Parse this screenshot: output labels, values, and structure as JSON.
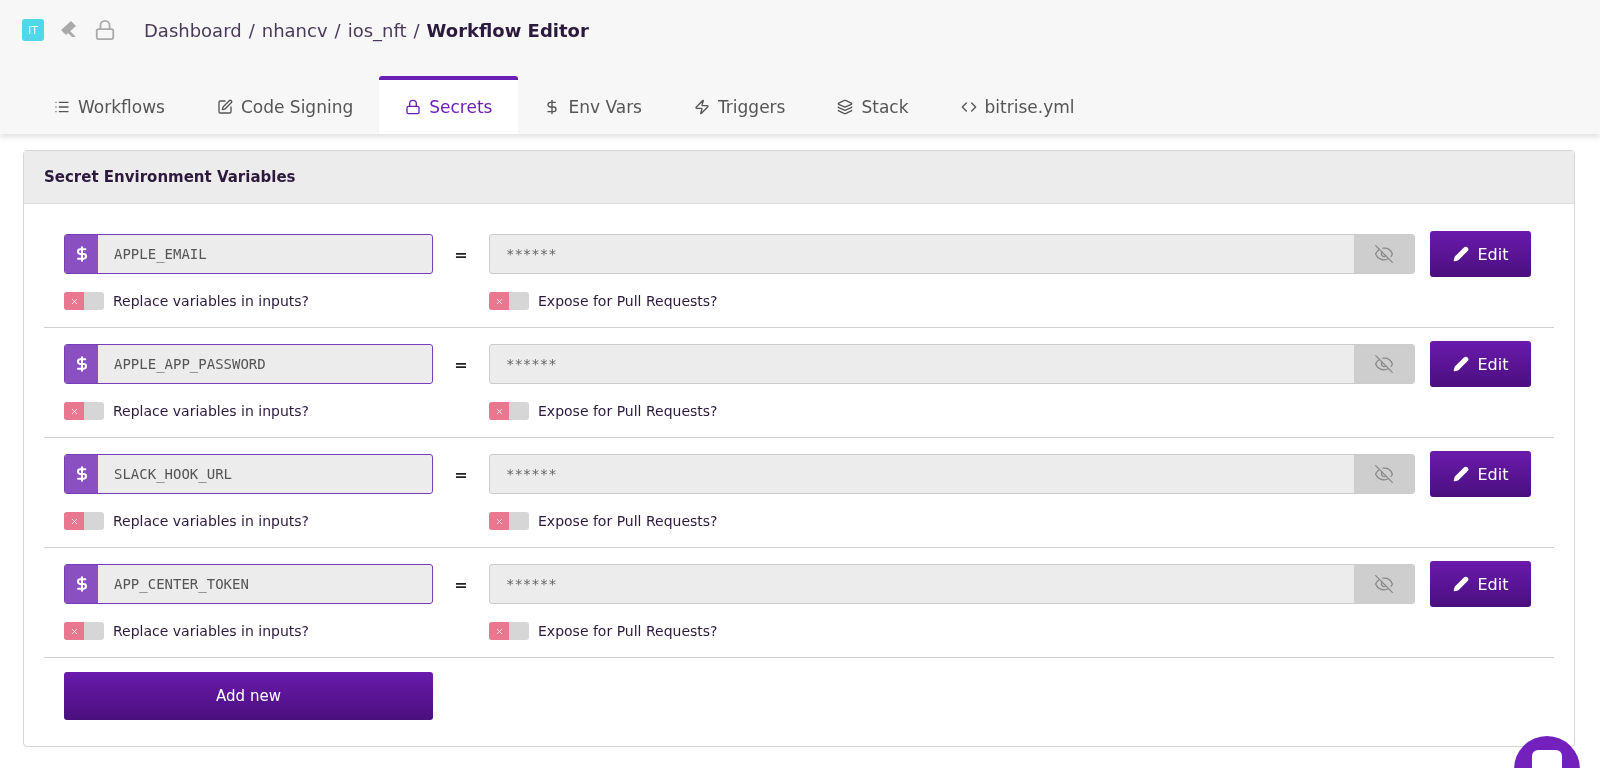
{
  "header": {
    "avatar": "IT",
    "breadcrumb": [
      "Dashboard",
      "nhancv",
      "ios_nft"
    ],
    "separator": "/",
    "current": "Workflow Editor"
  },
  "tabs": [
    {
      "label": "Workflows",
      "selected": false
    },
    {
      "label": "Code Signing",
      "selected": false
    },
    {
      "label": "Secrets",
      "selected": true
    },
    {
      "label": "Env Vars",
      "selected": false
    },
    {
      "label": "Triggers",
      "selected": false
    },
    {
      "label": "Stack",
      "selected": false
    },
    {
      "label": "bitrise.yml",
      "selected": false
    }
  ],
  "panel": {
    "title": "Secret Environment Variables",
    "secrets": [
      {
        "key": "APPLE_EMAIL",
        "equals": "=",
        "value": "******",
        "edit": "Edit",
        "replace": {
          "label": "Replace variables in inputs?",
          "on": false
        },
        "expose": {
          "label": "Expose for Pull Requests?",
          "on": false
        }
      },
      {
        "key": "APPLE_APP_PASSWORD",
        "equals": "=",
        "value": "******",
        "edit": "Edit",
        "replace": {
          "label": "Replace variables in inputs?",
          "on": false
        },
        "expose": {
          "label": "Expose for Pull Requests?",
          "on": false
        }
      },
      {
        "key": "SLACK_HOOK_URL",
        "equals": "=",
        "value": "******",
        "edit": "Edit",
        "replace": {
          "label": "Replace variables in inputs?",
          "on": false
        },
        "expose": {
          "label": "Expose for Pull Requests?",
          "on": false
        }
      },
      {
        "key": "APP_CENTER_TOKEN",
        "equals": "=",
        "value": "******",
        "edit": "Edit",
        "replace": {
          "label": "Replace variables in inputs?",
          "on": false
        },
        "expose": {
          "label": "Expose for Pull Requests?",
          "on": false
        }
      }
    ],
    "add": "Add new"
  }
}
